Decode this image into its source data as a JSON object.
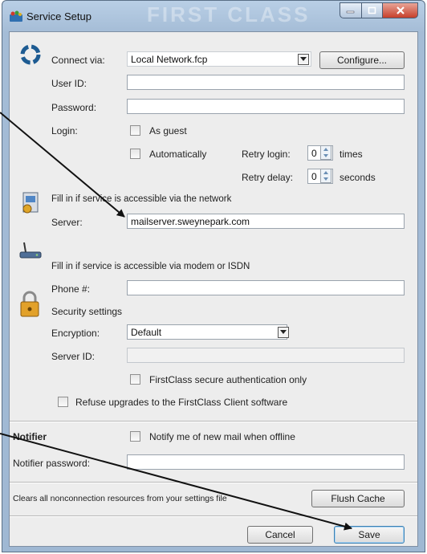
{
  "window": {
    "title": "Service Setup",
    "watermark": "FIRST CLASS",
    "controls": {
      "minimize": "minimize",
      "maximize": "maximize",
      "close": "close"
    }
  },
  "connection": {
    "connect_via_label": "Connect via:",
    "connect_via_value": "Local Network.fcp",
    "configure_button": "Configure...",
    "user_id_label": "User ID:",
    "user_id_value": "",
    "password_label": "Password:",
    "password_value": "",
    "login_label": "Login:",
    "as_guest_label": "As guest",
    "as_guest_checked": false,
    "automatically_label": "Automatically",
    "automatically_checked": false,
    "retry_login_label": "Retry login:",
    "retry_login_value": "0",
    "retry_login_unit": "times",
    "retry_delay_label": "Retry delay:",
    "retry_delay_value": "0",
    "retry_delay_unit": "seconds"
  },
  "network": {
    "hint": "Fill in if service is accessible via the network",
    "server_label": "Server:",
    "server_value": "mailserver.sweynepark.com"
  },
  "modem": {
    "hint": "Fill in if service is accessible via modem or ISDN",
    "phone_label": "Phone #:",
    "phone_value": ""
  },
  "security": {
    "heading": "Security settings",
    "encryption_label": "Encryption:",
    "encryption_value": "Default",
    "server_id_label": "Server ID:",
    "server_id_value": "",
    "secure_auth_label": "FirstClass secure authentication only",
    "secure_auth_checked": false,
    "refuse_upgrades_label": "Refuse upgrades to the FirstClass Client software",
    "refuse_upgrades_checked": false
  },
  "notifier": {
    "heading": "Notifier",
    "notify_label": "Notify me of new mail when offline",
    "notify_checked": false,
    "password_label": "Notifier password:",
    "password_value": ""
  },
  "cache": {
    "description": "Clears all nonconnection resources from your settings file",
    "flush_button": "Flush Cache"
  },
  "footer": {
    "cancel_button": "Cancel",
    "save_button": "Save"
  }
}
